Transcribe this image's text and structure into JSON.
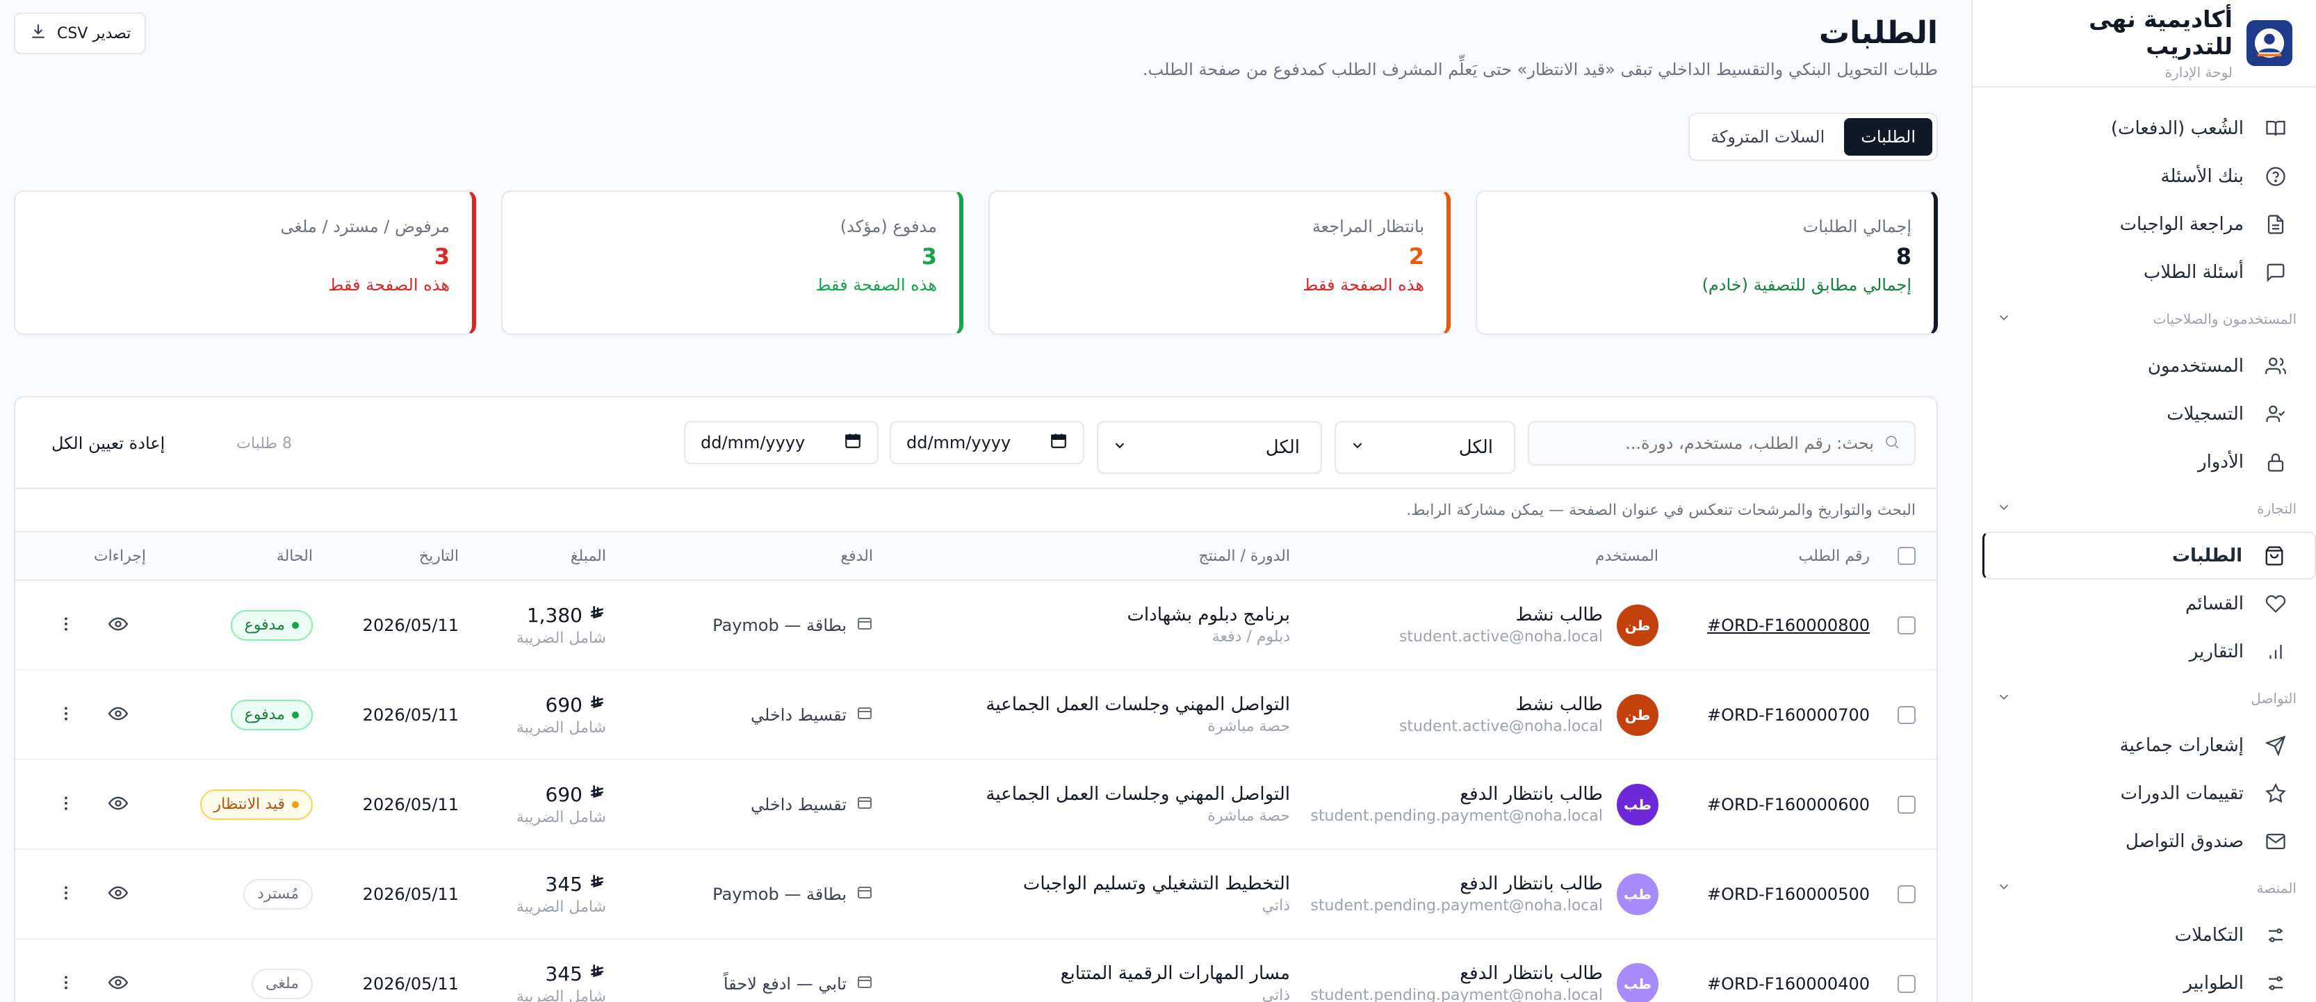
{
  "brand": {
    "title": "أكاديمية نهى للتدريب",
    "subtitle": "لوحة الإدارة"
  },
  "sidebar": {
    "items": [
      {
        "label": "الشُعب (الدفعات)",
        "icon": "book-icon"
      },
      {
        "label": "بنك الأسئلة",
        "icon": "question-icon"
      },
      {
        "label": "مراجعة الواجبات",
        "icon": "file-icon"
      },
      {
        "label": "أسئلة الطلاب",
        "icon": "chat-icon"
      }
    ],
    "sections": [
      {
        "title": "المستخدمون والصلاحيات",
        "items": [
          {
            "label": "المستخدمون",
            "icon": "users-icon"
          },
          {
            "label": "التسجيلات",
            "icon": "user-check-icon"
          },
          {
            "label": "الأدوار",
            "icon": "lock-icon"
          }
        ]
      },
      {
        "title": "التجارة",
        "items": [
          {
            "label": "الطلبات",
            "icon": "shopping-bag-icon"
          },
          {
            "label": "القسائم",
            "icon": "heart-icon"
          },
          {
            "label": "التقارير",
            "icon": "bar-chart-icon"
          }
        ]
      },
      {
        "title": "التواصل",
        "items": [
          {
            "label": "إشعارات جماعية",
            "icon": "send-icon"
          },
          {
            "label": "تقييمات الدورات",
            "icon": "star-icon"
          },
          {
            "label": "صندوق التواصل",
            "icon": "mail-icon"
          }
        ]
      },
      {
        "title": "المنصة",
        "items": [
          {
            "label": "التكاملات",
            "icon": "sliders-icon"
          },
          {
            "label": "الطوابير",
            "icon": "sliders-icon"
          }
        ]
      }
    ]
  },
  "page": {
    "title": "الطلبات",
    "subtitle": "طلبات التحويل البنكي والتقسيط الداخلي تبقى «قيد الانتظار» حتى يَعلِّم المشرف الطلب كمدفوع من صفحة الطلب.",
    "export_label": "تصدير CSV"
  },
  "tabs": [
    {
      "label": "الطلبات"
    },
    {
      "label": "السلات المتروكة"
    }
  ],
  "cards": [
    {
      "label": "إجمالي الطلبات",
      "value": "8",
      "note": "إجمالي مطابق للتصفية (خادم)",
      "accent": "#111827",
      "value_color": "#111827",
      "note_color": "#15803d"
    },
    {
      "label": "بانتظار المراجعة",
      "value": "2",
      "note": "هذه الصفحة فقط",
      "accent": "#ea580c",
      "value_color": "#ea580c",
      "note_color": "#dc2626"
    },
    {
      "label": "مدفوع (مؤكد)",
      "value": "3",
      "note": "هذه الصفحة فقط",
      "accent": "#16a34a",
      "value_color": "#16a34a",
      "note_color": "#16a34a"
    },
    {
      "label": "مرفوض / مسترد / ملغى",
      "value": "3",
      "note": "هذه الصفحة فقط",
      "accent": "#dc2626",
      "value_color": "#dc2626",
      "note_color": "#dc2626"
    }
  ],
  "filters": {
    "search_placeholder": "بحث: رقم الطلب، مستخدم، دورة...",
    "status_select": "الكل",
    "payment_select": "الكل",
    "date_from": "dd/mm/yyyy",
    "date_to": "dd/mm/yyyy",
    "count": "8 طلبات",
    "reset_label": "إعادة تعيين الكل",
    "hint": "البحث والتواريخ والمرشحات تنعكس في عنوان الصفحة — يمكن مشاركة الرابط."
  },
  "table": {
    "headers": {
      "order": "رقم الطلب",
      "user": "المستخدم",
      "course": "الدورة / المنتج",
      "payment": "الدفع",
      "amount": "المبلغ",
      "date": "التاريخ",
      "status": "الحالة",
      "actions": "إجراءات"
    },
    "rows": [
      {
        "order": "#ORD-F160000800",
        "underline": true,
        "initials": "طن",
        "avatar_color": "#c2410c",
        "name": "طالب نشط",
        "email": "student.active@noha.local",
        "course": "برنامج دبلوم بشهادات",
        "course_type": "دبلوم / دفعة",
        "payment": "بطاقة — Paymob",
        "amount": "1,380",
        "tax": "شامل الضريبة",
        "date": "2026/05/11",
        "status": "مدفوع",
        "status_kind": "paid"
      },
      {
        "order": "#ORD-F160000700",
        "underline": false,
        "initials": "طن",
        "avatar_color": "#c2410c",
        "name": "طالب نشط",
        "email": "student.active@noha.local",
        "course": "التواصل المهني وجلسات العمل الجماعية",
        "course_type": "حصة مباشرة",
        "payment": "تقسيط داخلي",
        "amount": "690",
        "tax": "شامل الضريبة",
        "date": "2026/05/11",
        "status": "مدفوع",
        "status_kind": "paid"
      },
      {
        "order": "#ORD-F160000600",
        "underline": false,
        "initials": "طب",
        "avatar_color": "#6d28d9",
        "name": "طالب بانتظار الدفع",
        "email": "student.pending.payment@noha.local",
        "course": "التواصل المهني وجلسات العمل الجماعية",
        "course_type": "حصة مباشرة",
        "payment": "تقسيط داخلي",
        "amount": "690",
        "tax": "شامل الضريبة",
        "date": "2026/05/11",
        "status": "قيد الانتظار",
        "status_kind": "pending"
      },
      {
        "order": "#ORD-F160000500",
        "underline": false,
        "initials": "طب",
        "avatar_color": "#a78bfa",
        "name": "طالب بانتظار الدفع",
        "email": "student.pending.payment@noha.local",
        "course": "التخطيط التشغيلي وتسليم الواجبات",
        "course_type": "ذاتي",
        "payment": "بطاقة — Paymob",
        "amount": "345",
        "tax": "شامل الضريبة",
        "date": "2026/05/11",
        "status": "مُسترد",
        "status_kind": "muted"
      },
      {
        "order": "#ORD-F160000400",
        "underline": false,
        "initials": "طب",
        "avatar_color": "#a78bfa",
        "name": "طالب بانتظار الدفع",
        "email": "student.pending.payment@noha.local",
        "course": "مسار المهارات الرقمية المتتابع",
        "course_type": "ذاتي",
        "payment": "تابي — ادفع لاحقاً",
        "amount": "345",
        "tax": "شامل الضريبة",
        "date": "2026/05/11",
        "status": "ملغى",
        "status_kind": "muted"
      }
    ]
  }
}
